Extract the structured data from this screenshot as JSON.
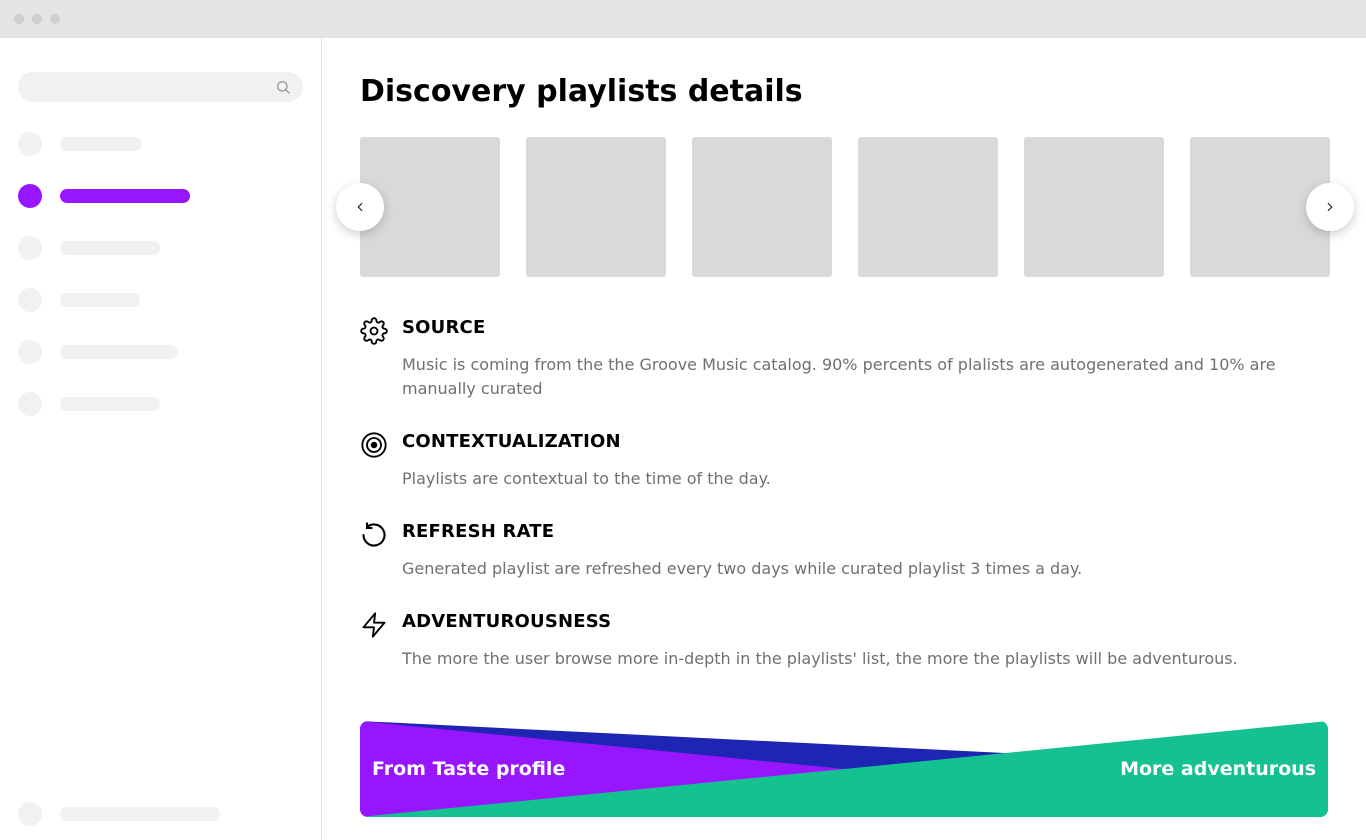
{
  "colors": {
    "accent": "#9716ff",
    "green": "#14c190",
    "blue": "#1d25b2"
  },
  "page": {
    "title": "Discovery playlists details"
  },
  "sections": {
    "source": {
      "title": "SOURCE",
      "desc": "Music is coming from the the Groove Music catalog. 90% percents of plalists are autogenerated and 10% are manually curated"
    },
    "contextualization": {
      "title": "CONTEXTUALIZATION",
      "desc": "Playlists are contextual to the time of the day."
    },
    "refresh_rate": {
      "title": "REFRESH RATE",
      "desc": "Generated playlist are refreshed every two days while curated playlist 3 times a day."
    },
    "adventurousness": {
      "title": "ADVENTUROUSNESS",
      "desc": "The more the user browse more in-depth in the playlists' list, the more the playlists will be adventurous."
    }
  },
  "adventurousness_bar": {
    "left_label": "From Taste profile",
    "right_label": "More adventurous"
  }
}
